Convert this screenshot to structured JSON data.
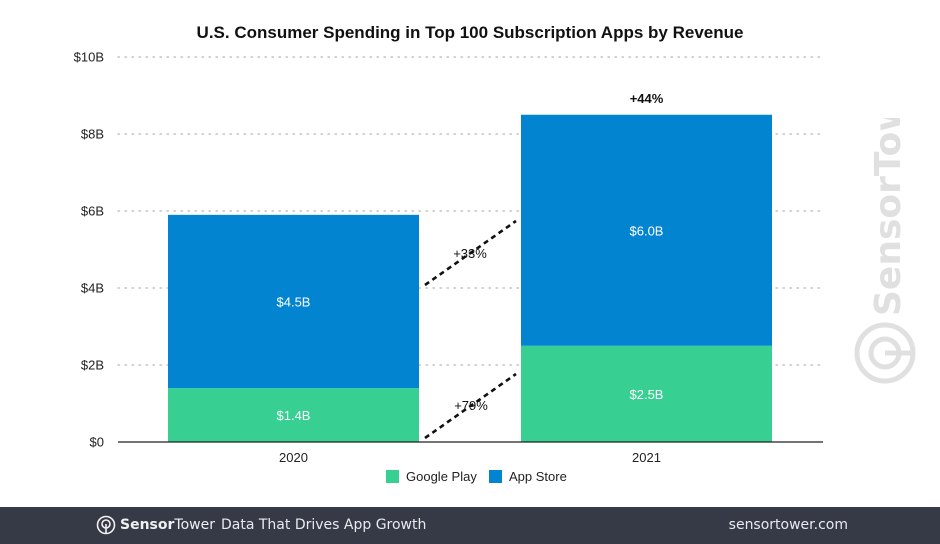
{
  "chart_data": {
    "type": "bar",
    "stacked": true,
    "title": "U.S. Consumer Spending in Top 100 Subscription Apps by Revenue",
    "xlabel": "",
    "ylabel": "",
    "categories": [
      "2020",
      "2021"
    ],
    "series": [
      {
        "name": "Google Play",
        "color": "#38cf93",
        "values": [
          1.4,
          2.5
        ],
        "labels": [
          "$1.4B",
          "$2.5B"
        ]
      },
      {
        "name": "App Store",
        "color": "#0384d1",
        "values": [
          4.5,
          6.0
        ],
        "labels": [
          "$4.5B",
          "$6.0B"
        ]
      }
    ],
    "ylim": [
      0,
      10
    ],
    "yticks": [
      0,
      2,
      4,
      6,
      8,
      10
    ],
    "ytick_labels": [
      "$0",
      "$2B",
      "$4B",
      "$6B",
      "$8B",
      "$10B"
    ],
    "grid": true,
    "legend": {
      "placement": "bottom-center",
      "entries": [
        "Google Play",
        "App Store"
      ]
    },
    "annotations": {
      "total_growth": "+44%",
      "app_store_growth": "+33%",
      "google_play_growth": "+79%"
    }
  },
  "watermark": {
    "text": "SensorTower"
  },
  "footer": {
    "brand_bold": "Sensor",
    "brand_regular": "Tower",
    "tagline": "Data That Drives App Growth",
    "url": "sensortower.com",
    "background": "#353a46"
  }
}
